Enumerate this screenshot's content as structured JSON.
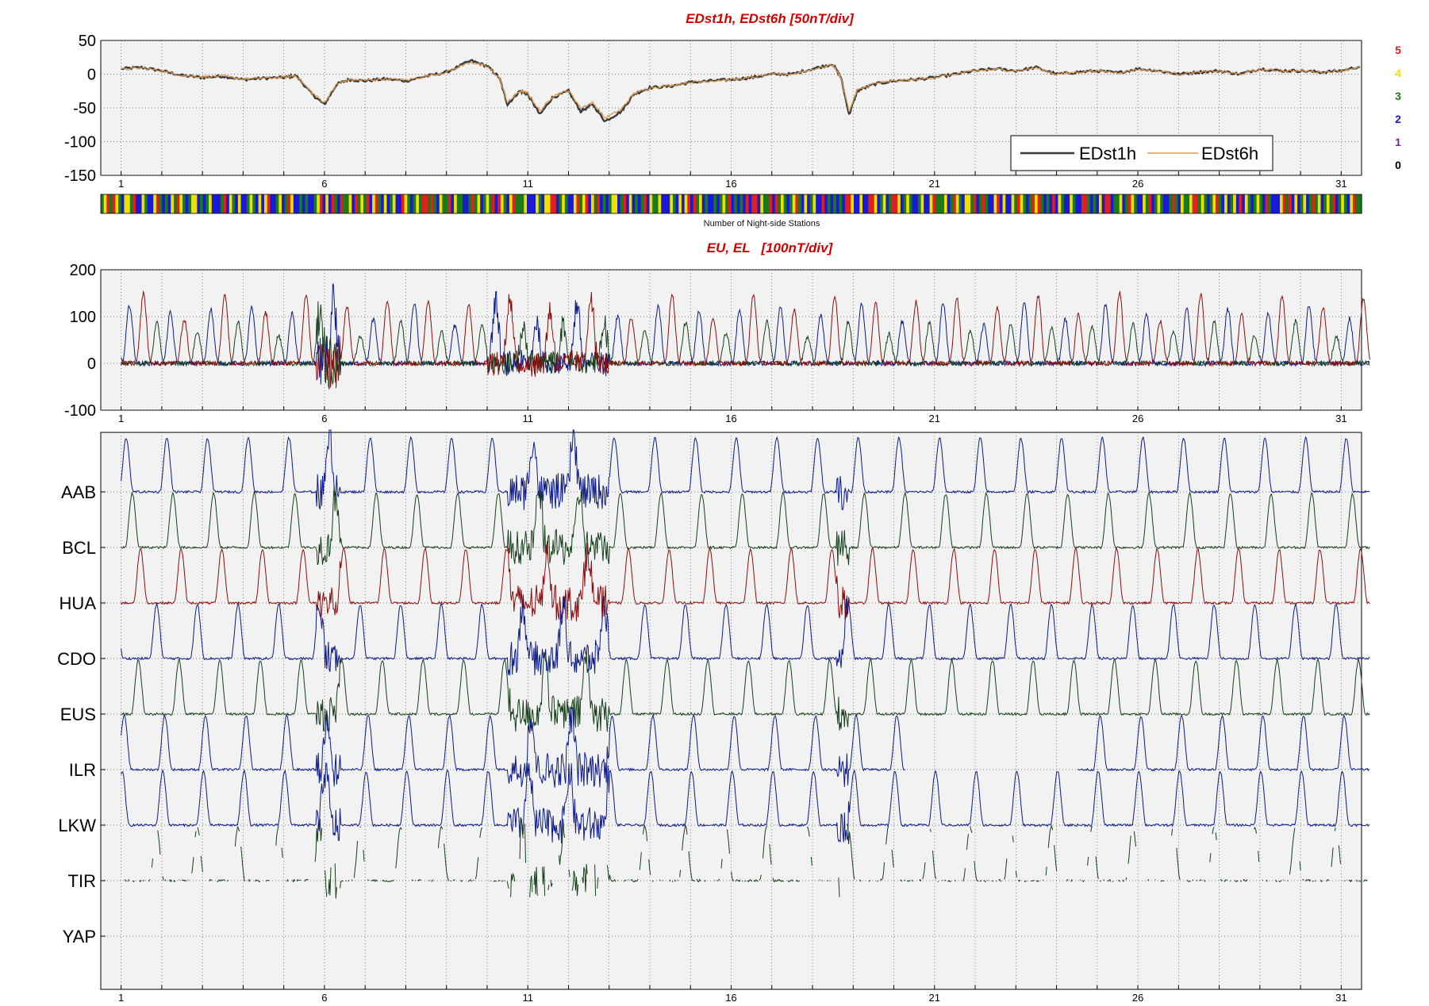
{
  "colors": {
    "axes_bg": "#f2f2f2",
    "grid": "#555555",
    "title": "#d40000",
    "edst1h": "#3a3a3a",
    "edst6h": "#d89a54",
    "series_blue": "#0c1a8a",
    "series_green": "#163f1a",
    "series_red": "#8b0d0d",
    "count_colors": {
      "0": "#000000",
      "1": "#7a1fa2",
      "2": "#1a1ad4",
      "3": "#1a7a1a",
      "4": "#f0e000",
      "5": "#e02020"
    }
  },
  "chart_data": [
    {
      "id": "edst_panel",
      "type": "line",
      "title": "EDst1h, EDst6h [50nT/div]",
      "x_ticks": [
        1,
        6,
        11,
        16,
        21,
        26,
        31
      ],
      "xlim": [
        0.5,
        31.5
      ],
      "ylim": [
        -150,
        50
      ],
      "y_ticks": [
        50,
        0,
        -50,
        -100,
        -150
      ],
      "grid": true,
      "legend": {
        "position": "bottom-right",
        "entries": [
          "EDst1h",
          "EDst6h"
        ]
      },
      "series": [
        {
          "name": "EDst1h",
          "color": "#3a3a3a",
          "x": [
            1,
            1.5,
            2,
            2.5,
            3,
            3.5,
            4,
            4.5,
            5,
            5.3,
            5.7,
            6,
            6.3,
            6.6,
            7,
            7.5,
            8,
            8.5,
            9,
            9.6,
            10,
            10.3,
            10.5,
            10.8,
            11,
            11.3,
            11.6,
            12,
            12.3,
            12.6,
            12.9,
            13.3,
            13.6,
            14,
            14.5,
            15,
            15.5,
            16,
            16.5,
            17,
            17.5,
            18,
            18.5,
            18.7,
            18.9,
            19.1,
            19.5,
            20,
            20.5,
            21,
            21.5,
            22,
            22.5,
            23,
            23.5,
            24,
            24.5,
            25,
            25.5,
            26,
            26.5,
            27,
            27.5,
            28,
            28.5,
            29,
            29.5,
            30,
            30.5,
            31,
            31.5
          ],
          "values": [
            8,
            10,
            5,
            -2,
            -5,
            -3,
            -8,
            -6,
            -5,
            -2,
            -30,
            -45,
            -15,
            -8,
            -10,
            -7,
            -10,
            -3,
            3,
            20,
            12,
            -5,
            -45,
            -25,
            -30,
            -60,
            -35,
            -25,
            -55,
            -45,
            -70,
            -55,
            -30,
            -20,
            -18,
            -12,
            -10,
            -8,
            -5,
            0,
            0,
            8,
            15,
            -5,
            -60,
            -25,
            -15,
            -10,
            -8,
            -5,
            0,
            5,
            8,
            5,
            10,
            0,
            3,
            5,
            2,
            8,
            5,
            0,
            3,
            5,
            0,
            8,
            5,
            5,
            3,
            5,
            12
          ]
        },
        {
          "name": "EDst6h",
          "color": "#d89a54",
          "x": [
            1,
            1.5,
            2,
            2.5,
            3,
            3.5,
            4,
            4.5,
            5,
            5.3,
            5.7,
            6,
            6.3,
            6.6,
            7,
            7.5,
            8,
            8.5,
            9,
            9.6,
            10,
            10.3,
            10.5,
            10.8,
            11,
            11.3,
            11.6,
            12,
            12.3,
            12.6,
            12.9,
            13.3,
            13.6,
            14,
            14.5,
            15,
            15.5,
            16,
            16.5,
            17,
            17.5,
            18,
            18.5,
            18.7,
            18.9,
            19.1,
            19.5,
            20,
            20.5,
            21,
            21.5,
            22,
            22.5,
            23,
            23.5,
            24,
            24.5,
            25,
            25.5,
            26,
            26.5,
            27,
            27.5,
            28,
            28.5,
            29,
            29.5,
            30,
            30.5,
            31,
            31.5
          ],
          "values": [
            7,
            9,
            5,
            -2,
            -4,
            -3,
            -7,
            -6,
            -5,
            -2,
            -28,
            -42,
            -15,
            -8,
            -9,
            -7,
            -9,
            -3,
            3,
            18,
            11,
            -5,
            -42,
            -25,
            -28,
            -55,
            -33,
            -24,
            -50,
            -42,
            -65,
            -52,
            -29,
            -20,
            -17,
            -12,
            -10,
            -8,
            -5,
            0,
            0,
            7,
            14,
            -5,
            -55,
            -24,
            -14,
            -10,
            -8,
            -5,
            0,
            5,
            7,
            5,
            9,
            0,
            3,
            5,
            2,
            7,
            5,
            0,
            3,
            5,
            0,
            7,
            5,
            5,
            3,
            5,
            11
          ]
        }
      ]
    },
    {
      "id": "night_stations_bar",
      "type": "heatmap",
      "xlabel": "Number of Night-side Stations",
      "legend_labels": [
        "5",
        "4",
        "3",
        "2",
        "1",
        "0"
      ],
      "pattern": [
        3,
        4,
        2,
        3,
        5,
        4,
        3,
        2,
        4,
        4,
        3,
        5,
        2,
        3,
        4,
        3,
        2,
        2,
        4,
        5,
        3,
        4,
        3,
        2,
        4,
        3,
        5,
        4,
        3,
        2,
        3,
        4,
        4,
        2,
        3,
        5,
        3,
        4,
        2,
        3,
        4,
        3,
        5,
        2,
        4,
        3,
        3,
        4,
        2,
        5,
        3,
        4,
        3,
        2,
        4,
        3,
        4,
        5,
        2,
        3,
        3,
        4,
        2,
        3,
        5,
        4,
        3,
        2,
        3,
        4,
        3,
        5,
        2,
        3,
        4,
        3,
        2,
        4,
        3,
        5,
        3,
        2,
        4,
        3,
        3,
        4,
        2,
        5,
        3,
        4,
        3,
        2,
        3,
        4,
        5,
        3,
        2,
        4,
        3,
        3,
        4,
        2,
        3,
        5,
        4,
        3,
        2,
        3,
        4,
        3,
        2,
        5,
        3,
        4,
        3,
        2,
        4,
        3,
        3,
        5,
        2,
        4,
        3,
        3,
        4,
        2,
        3,
        5,
        3,
        4,
        2,
        3,
        4,
        3,
        5,
        2,
        3,
        4,
        3,
        2,
        4,
        5,
        3,
        3
      ]
    },
    {
      "id": "eu_el_panel",
      "type": "line",
      "title": "EU, EL   [100nT/div]",
      "x_ticks": [
        1,
        6,
        11,
        16,
        21,
        26,
        31
      ],
      "xlim": [
        0.5,
        31.5
      ],
      "ylim": [
        -100,
        200
      ],
      "y_ticks": [
        200,
        100,
        0,
        -100
      ],
      "grid": true,
      "series": [
        {
          "color": "#0c1a8a",
          "phase": 0.0,
          "amplitude": 130
        },
        {
          "color": "#163f1a",
          "phase": 0.33,
          "amplitude": 90
        },
        {
          "color": "#8b0d0d",
          "phase": 0.66,
          "amplitude": 150
        }
      ]
    },
    {
      "id": "stations_panel",
      "type": "line",
      "x_ticks": [
        1,
        6,
        11,
        16,
        21,
        26,
        31
      ],
      "xlim": [
        0.5,
        31.5
      ],
      "grid": true,
      "stations": [
        {
          "name": "AAB",
          "color": "#0c1a8a",
          "phase": 0.05,
          "gap": null
        },
        {
          "name": "BCL",
          "color": "#163f1a",
          "phase": 0.9,
          "gap": null
        },
        {
          "name": "HUA",
          "color": "#8b0d0d",
          "phase": 0.7,
          "gap": null
        },
        {
          "name": "CDO",
          "color": "#0c1a8a",
          "phase": 0.3,
          "gap": null
        },
        {
          "name": "EUS",
          "color": "#163f1a",
          "phase": 0.75,
          "gap": null
        },
        {
          "name": "ILR",
          "color": "#0c1a8a",
          "phase": 0.1,
          "gap": [
            20.3,
            24.5
          ]
        },
        {
          "name": "LKW",
          "color": "#0c1a8a",
          "phase": 0.15,
          "gap": null
        },
        {
          "name": "TIR",
          "color": "#163f1a",
          "phase": 0.3,
          "dashed": true,
          "gap": null
        },
        {
          "name": "YAP",
          "color": "#163f1a",
          "phase": 0.0,
          "empty": true,
          "gap": null
        }
      ]
    }
  ]
}
